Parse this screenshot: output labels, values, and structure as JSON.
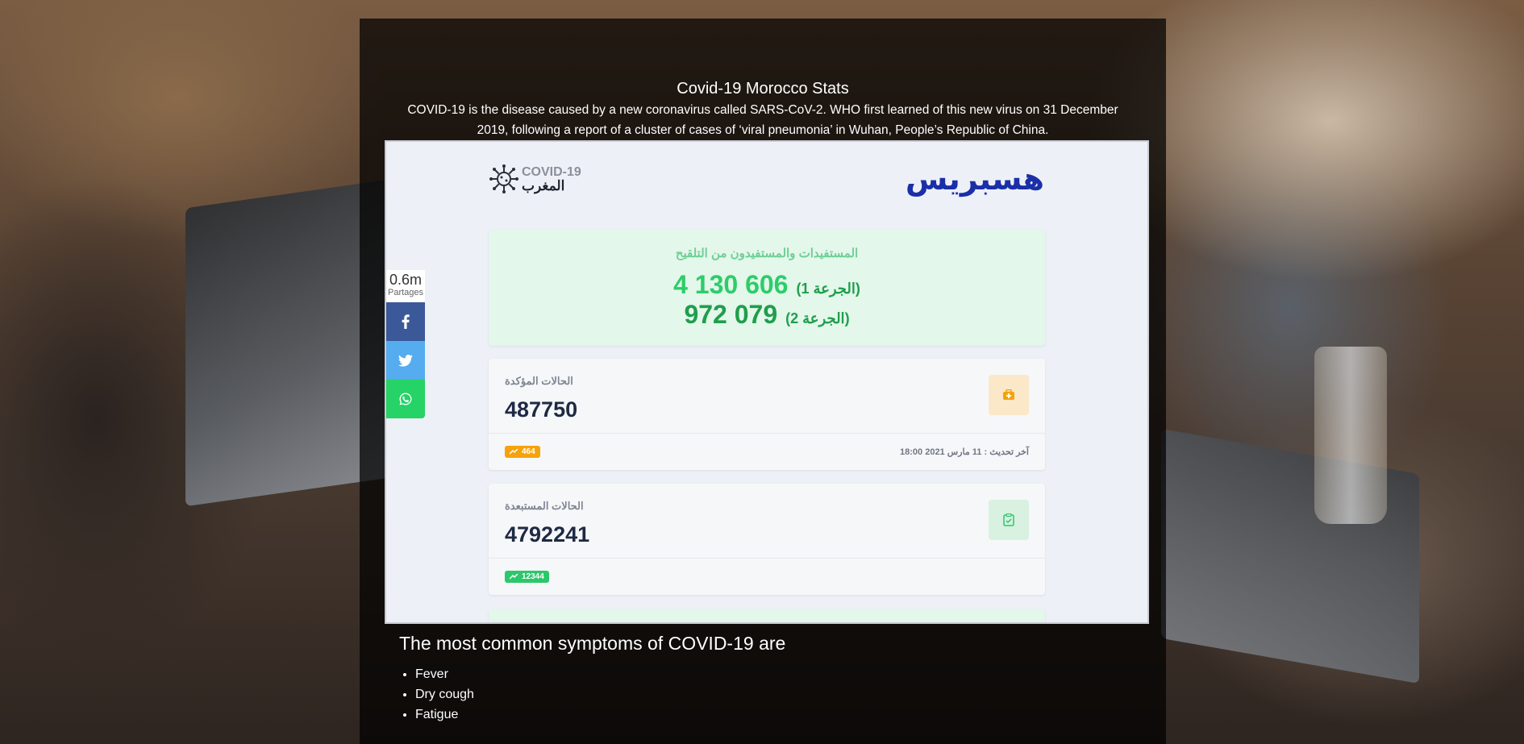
{
  "page": {
    "title": "Covid-19 Morocco Stats",
    "intro": "COVID-19 is the disease caused by a new coronavirus called SARS-CoV-2. WHO first learned of this new virus on 31 December 2019, following a report of a cluster of cases of ‘viral pneumonia’ in Wuhan, People’s Republic of China."
  },
  "widget": {
    "logo_left_en": "COVID-19",
    "logo_left_ar": "المغرب",
    "logo_right": "هسبريس",
    "vaccination": {
      "title": "المستفيدات والمستفيدون من التلقيح",
      "dose1_value": "4 130 606",
      "dose1_label": "(الجرعة 1)",
      "dose2_value": "972 079",
      "dose2_label": "(الجرعة 2)"
    },
    "confirmed": {
      "label": "الحالات المؤكدة",
      "value": "487750",
      "badge": "464",
      "updated": "آخر تحديث : 11 مارس 2021 18:00",
      "icon": "medical-kit-icon"
    },
    "excluded": {
      "label": "الحالات المستبعدة",
      "value": "4792241",
      "badge": "12344",
      "icon": "clipboard-check-icon"
    },
    "colors": {
      "vacc_bg": "#e3f7ea",
      "dose1": "#2ccd6a",
      "dose2": "#1f9e4c",
      "confirmed_badge": "#f5a30c",
      "excluded_badge": "#2cc76a",
      "brand_blue": "#1b2fa8"
    }
  },
  "share": {
    "count": "0.6m",
    "count_label": "Partages",
    "buttons": [
      {
        "icon": "facebook-icon",
        "color": "#3b5998"
      },
      {
        "icon": "twitter-icon",
        "color": "#55acee"
      },
      {
        "icon": "whatsapp-icon",
        "color": "#25d366"
      }
    ]
  },
  "symptoms": {
    "title": "The most common symptoms of COVID-19 are",
    "items": [
      "Fever",
      "Dry cough",
      "Fatigue"
    ]
  }
}
